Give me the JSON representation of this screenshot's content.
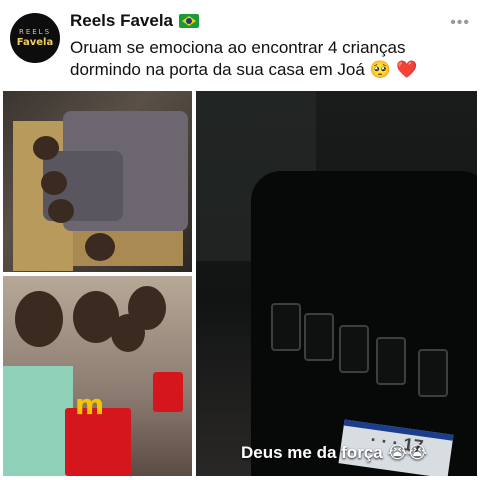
{
  "post": {
    "account_name": "Reels Favela",
    "flag_icon": "brazil-flag-icon",
    "avatar": {
      "line1": "REELS",
      "line2": "Favela"
    },
    "caption": "Oruam se emociona ao encontrar 4 crianças dormindo na porta da sua casa em Joá",
    "caption_emojis": "🥺 ❤️",
    "more_label": "•••"
  },
  "media": {
    "overlay_text": "Deus me da força",
    "overlay_emojis": "😭😭"
  },
  "colors": {
    "background": "#ffffff",
    "text": "#111111",
    "overlay_text": "#ffffff"
  }
}
